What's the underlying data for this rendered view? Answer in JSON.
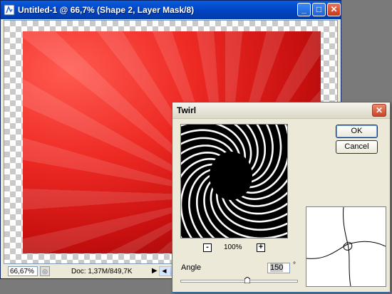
{
  "document_window": {
    "title": "Untitled-1 @ 66,7% (Shape 2, Layer Mask/8)",
    "controls": {
      "minimize": "_",
      "maximize": "□",
      "close": "✕"
    },
    "status": {
      "zoom": "66,67%",
      "doc_info": "Doc: 1,37M/849,7K",
      "menu_arrow": "▶"
    }
  },
  "twirl_dialog": {
    "title": "Twirl",
    "close": "✕",
    "ok_label": "OK",
    "cancel_label": "Cancel",
    "zoom_minus": "-",
    "zoom_plus": "+",
    "zoom_level": "100%",
    "angle_label": "Angle",
    "angle_value": "150",
    "degree_symbol": "°"
  },
  "colors": {
    "xp_titlebar_blue": "#0047c8",
    "artwork_red": "#ee2a24",
    "dialog_bg": "#ece9d8"
  }
}
